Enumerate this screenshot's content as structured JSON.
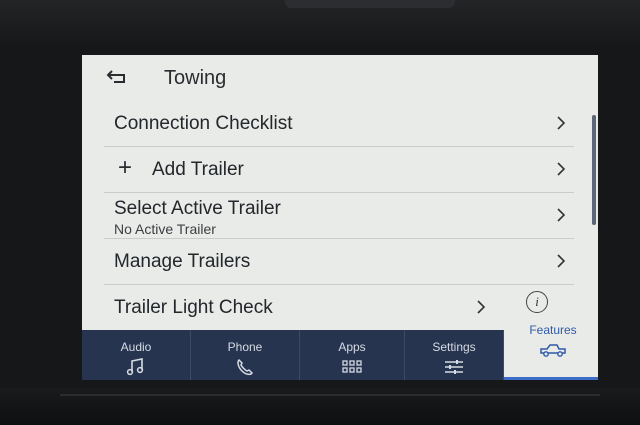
{
  "header": {
    "title": "Towing"
  },
  "menu": [
    {
      "label": "Connection Checklist"
    },
    {
      "label": "Add Trailer"
    },
    {
      "label": "Select Active Trailer",
      "sublabel": "No Active Trailer"
    },
    {
      "label": "Manage Trailers"
    },
    {
      "label": "Trailer Light Check"
    }
  ],
  "nav": [
    {
      "label": "Audio",
      "icon": "music-note-icon"
    },
    {
      "label": "Phone",
      "icon": "phone-icon"
    },
    {
      "label": "Apps",
      "icon": "grid-icon"
    },
    {
      "label": "Settings",
      "icon": "sliders-icon"
    },
    {
      "label": "Features",
      "icon": "truck-icon"
    }
  ],
  "colors": {
    "screen_bg": "#e9ebe8",
    "navbar_bg": "#26344f",
    "active_accent": "#3b6cc8"
  }
}
